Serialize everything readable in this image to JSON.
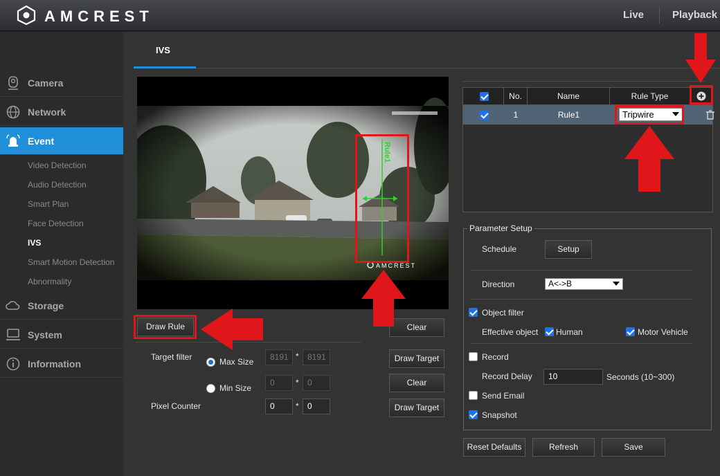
{
  "header": {
    "brand": "AMCREST",
    "links": {
      "live": "Live",
      "playback": "Playback"
    }
  },
  "sidebar": {
    "items": [
      {
        "label": "Camera",
        "icon": "camera-icon"
      },
      {
        "label": "Network",
        "icon": "globe-icon"
      },
      {
        "label": "Event",
        "icon": "alarm-icon"
      },
      {
        "label": "Storage",
        "icon": "cloud-icon"
      },
      {
        "label": "System",
        "icon": "monitor-icon"
      },
      {
        "label": "Information",
        "icon": "info-icon"
      }
    ],
    "event_subitems": [
      "Video Detection",
      "Audio Detection",
      "Smart Plan",
      "Face Detection",
      "IVS",
      "Smart Motion Detection",
      "Abnormality"
    ],
    "active_main": "Event",
    "active_sub": "IVS"
  },
  "tab": {
    "label": "IVS"
  },
  "video": {
    "timestamp": "",
    "rule_label": "Rule1",
    "watermark": "AMCREST"
  },
  "controls": {
    "draw_rule": "Draw Rule",
    "clear": "Clear",
    "draw_target": "Draw Target",
    "target_filter": "Target filter",
    "max_size": "Max Size",
    "min_size": "Min Size",
    "max_w": "8191",
    "max_h": "8191",
    "min_w": "0",
    "min_h": "0",
    "pixel_counter": "Pixel Counter",
    "pix_w": "0",
    "pix_h": "0",
    "times": "*"
  },
  "rules_table": {
    "headers": {
      "no": "No.",
      "name": "Name",
      "rule_type": "Rule Type"
    },
    "rows": [
      {
        "no": "1",
        "name": "Rule1",
        "rule_type": "Tripwire"
      }
    ]
  },
  "params": {
    "legend": "Parameter Setup",
    "schedule": "Schedule",
    "setup": "Setup",
    "direction": "Direction",
    "direction_value": "A<->B",
    "object_filter": "Object filter",
    "effective_object": "Effective object",
    "human": "Human",
    "motor_vehicle": "Motor Vehicle",
    "record": "Record",
    "record_delay": "Record Delay",
    "record_delay_value": "10",
    "seconds": "Seconds (10~300)",
    "send_email": "Send Email",
    "snapshot": "Snapshot"
  },
  "footer": {
    "reset": "Reset Defaults",
    "refresh": "Refresh",
    "save": "Save"
  },
  "colors": {
    "accent": "#1e8fd8",
    "highlight": "#e0161b",
    "selected_row": "#516476"
  }
}
